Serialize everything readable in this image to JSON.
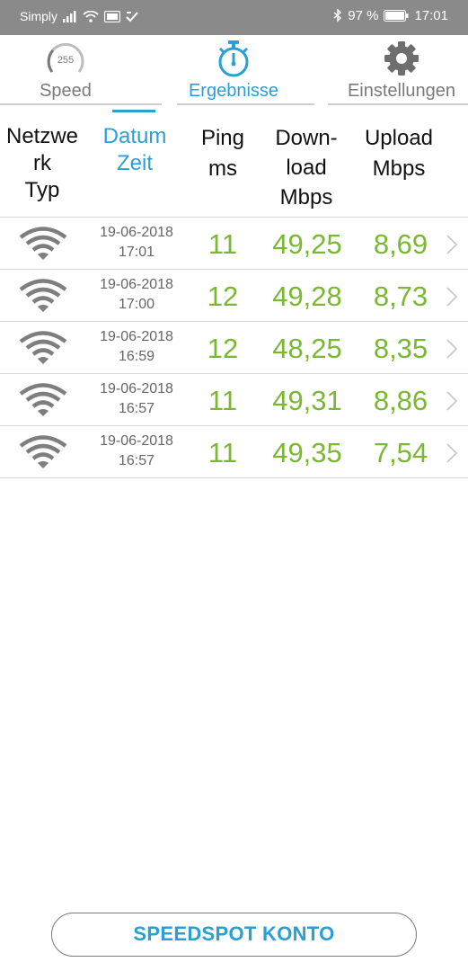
{
  "status_bar": {
    "carrier": "Simply",
    "battery": "97 %",
    "time": "17:01"
  },
  "tabs": [
    {
      "label": "Speed",
      "icon": "speedometer-icon",
      "gauge_text": "255"
    },
    {
      "label": "Ergebnisse",
      "icon": "stopwatch-icon"
    },
    {
      "label": "Einstellungen",
      "icon": "gear-icon"
    }
  ],
  "active_tab": "Ergebnisse",
  "table": {
    "headers": {
      "network": [
        "Netzwe",
        "rk",
        "Typ"
      ],
      "datetime": [
        "Datum",
        "Zeit"
      ],
      "ping": [
        "Ping",
        "ms"
      ],
      "download": [
        "Down-",
        "load",
        "Mbps"
      ],
      "upload": [
        "Upload",
        "Mbps"
      ]
    },
    "sorted_column": "datetime",
    "rows": [
      {
        "network": "wifi",
        "date": "19-06-2018",
        "time": "17:01",
        "ping": "11",
        "download": "49,25",
        "upload": "8,69"
      },
      {
        "network": "wifi",
        "date": "19-06-2018",
        "time": "17:00",
        "ping": "12",
        "download": "49,28",
        "upload": "8,73"
      },
      {
        "network": "wifi",
        "date": "19-06-2018",
        "time": "16:59",
        "ping": "12",
        "download": "48,25",
        "upload": "8,35"
      },
      {
        "network": "wifi",
        "date": "19-06-2018",
        "time": "16:57",
        "ping": "11",
        "download": "49,31",
        "upload": "8,86"
      },
      {
        "network": "wifi",
        "date": "19-06-2018",
        "time": "16:57",
        "ping": "11",
        "download": "49,35",
        "upload": "7,54"
      }
    ]
  },
  "account_button": "SPEEDSPOT KONTO",
  "colors": {
    "accent_blue": "#2a9fd6",
    "value_green": "#7ab733",
    "status_bar_gray": "#8a8a8a"
  }
}
